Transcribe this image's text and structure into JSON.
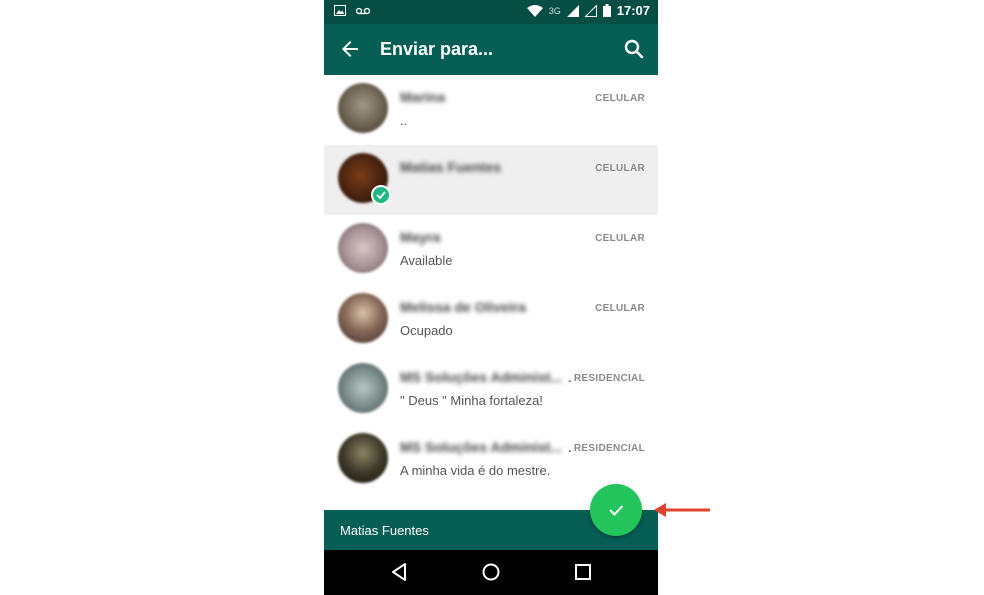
{
  "status_bar": {
    "time": "17:07",
    "network": "3G",
    "icons": [
      "image-notification-icon",
      "voicemail-icon",
      "wifi-icon",
      "signal-icon",
      "signal-empty-icon",
      "battery-icon"
    ]
  },
  "toolbar": {
    "title": "Enviar para...",
    "back_icon": "arrow-left-icon",
    "search_icon": "search-icon"
  },
  "contacts": [
    {
      "name": "Marina",
      "type": "CELULAR",
      "status": "..",
      "selected": false,
      "avatar_color": "#6b6152"
    },
    {
      "name": "Matias Fuentes",
      "type": "CELULAR",
      "status": "",
      "selected": true,
      "avatar_color": "#4a2410"
    },
    {
      "name": "Mayra",
      "type": "CELULAR",
      "status": "Available",
      "selected": false,
      "avatar_color": "#a9959a"
    },
    {
      "name": "Melissa de Oliveira",
      "type": "CELULAR",
      "status": "Ocupado",
      "selected": false,
      "avatar_color": "#8a6b5b"
    },
    {
      "name": "MS Soluções Administ...",
      "type": "RESIDENCIAL",
      "status": "\" Deus \" Minha fortaleza!",
      "selected": false,
      "avatar_color": "#7c8d8c"
    },
    {
      "name": "MS Soluções Administ...",
      "type": "RESIDENCIAL",
      "status": "A minha vida é do mestre.",
      "selected": false,
      "avatar_color": "#3e3a2a"
    }
  ],
  "footer": {
    "selected_name": "Matias Fuentes"
  },
  "colors": {
    "header": "#075e54",
    "fab": "#23c45b",
    "check_badge": "#1eb980",
    "annotation_arrow": "#e0432b"
  }
}
